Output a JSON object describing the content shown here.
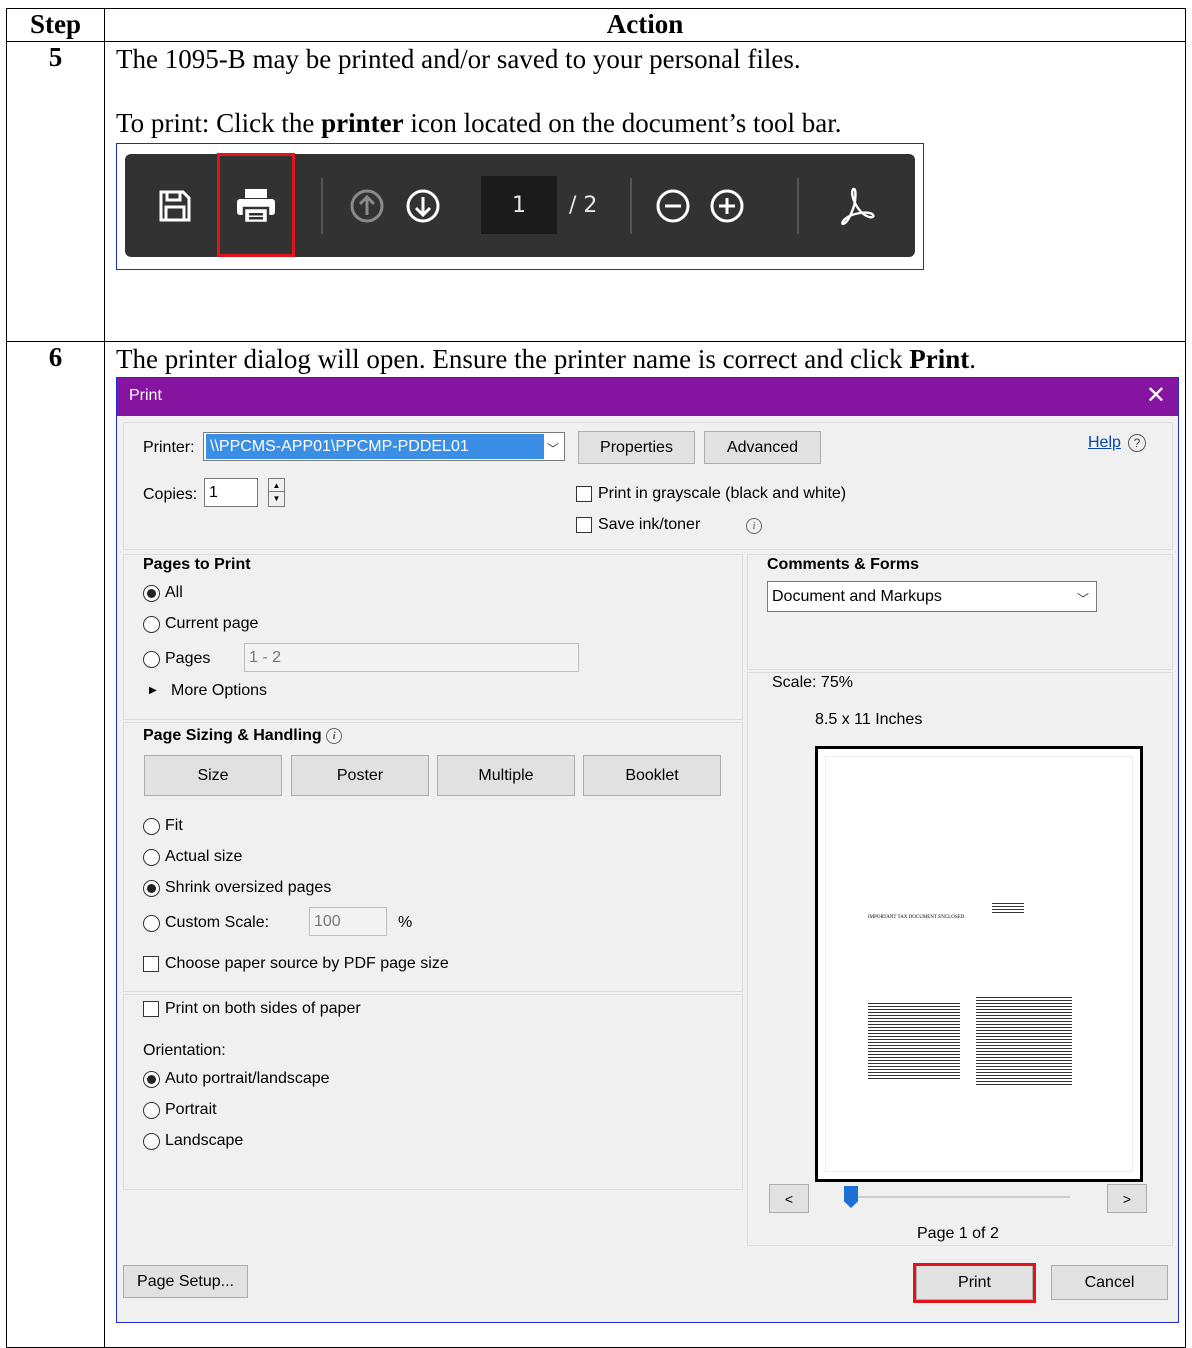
{
  "table": {
    "header_step": "Step",
    "header_action": "Action"
  },
  "step5": {
    "number": "5",
    "line1": "The 1095-B may be printed and/or saved to your personal files.",
    "line2_prefix": "To print:  Click the ",
    "line2_bold": "printer",
    "line2_suffix": " icon located on the document’s tool bar."
  },
  "toolbar": {
    "page_current": "1",
    "page_total": "/ 2",
    "icons": [
      "save-icon",
      "printer-icon",
      "page-up-icon",
      "page-down-icon",
      "zoom-out-icon",
      "zoom-in-icon",
      "acrobat-icon"
    ]
  },
  "step6": {
    "number": "6",
    "line_prefix": "The printer dialog will open.  Ensure the printer name is correct and click ",
    "line_bold": "Print",
    "line_suffix": "."
  },
  "dialog": {
    "title": "Print",
    "close": "✕",
    "printer_label": "Printer:",
    "printer_value": "\\\\PPCMS-APP01\\PPCMP-PDDEL01",
    "properties": "Properties",
    "advanced": "Advanced",
    "help": "Help",
    "copies_label": "Copies:",
    "copies_value": "1",
    "grayscale": "Print in grayscale (black and white)",
    "save_ink": "Save ink/toner",
    "pages_to_print": {
      "heading": "Pages to Print",
      "all": "All",
      "current": "Current page",
      "pages": "Pages",
      "pages_value": "1 - 2",
      "more": "More Options"
    },
    "comments_forms": {
      "heading": "Comments & Forms",
      "value": "Document and Markups"
    },
    "sizing": {
      "heading": "Page Sizing & Handling",
      "size": "Size",
      "poster": "Poster",
      "multiple": "Multiple",
      "booklet": "Booklet",
      "fit": "Fit",
      "actual": "Actual size",
      "shrink": "Shrink oversized pages",
      "custom": "Custom Scale:",
      "custom_value": "100",
      "percent": "%",
      "paper_source": "Choose paper source by PDF page size"
    },
    "both_sides": "Print on both sides of paper",
    "orientation": {
      "heading": "Orientation:",
      "auto": "Auto portrait/landscape",
      "portrait": "Portrait",
      "landscape": "Landscape"
    },
    "preview": {
      "scale": "Scale:  75%",
      "paper": "8.5 x 11 Inches",
      "prev": "<",
      "next": ">",
      "page_of": "Page 1 of 2",
      "doc_text": "IMPORTANT TAX DOCUMENT ENCLOSED"
    },
    "page_setup": "Page Setup...",
    "print": "Print",
    "cancel": "Cancel"
  }
}
